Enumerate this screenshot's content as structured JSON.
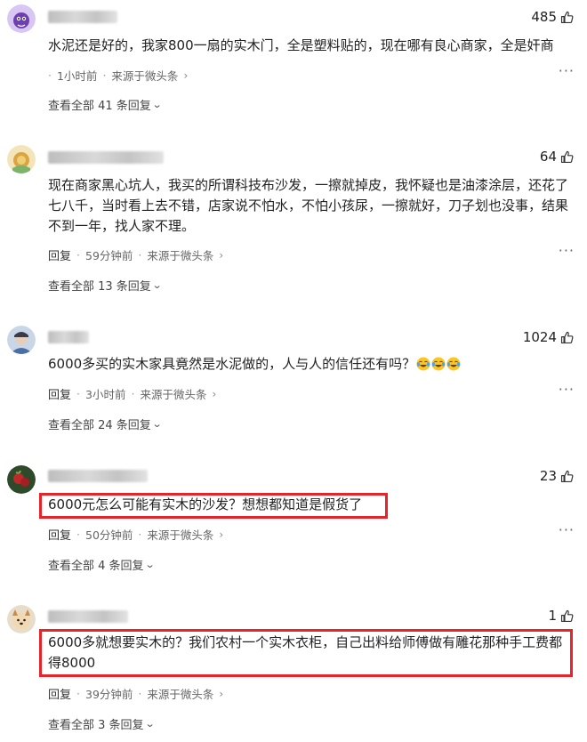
{
  "comments": [
    {
      "likes": "485",
      "text": "水泥还是好的，我家800一扇的实木门，全是塑料贴的，现在哪有良心商家，全是奸商",
      "time": "1小时前",
      "source": "来源于微头条",
      "has_reply_label": false,
      "view_all": "查看全部 41 条回复"
    },
    {
      "likes": "64",
      "text": "现在商家黑心坑人，我买的所谓科技布沙发，一擦就掉皮，我怀疑也是油漆涂层，还花了七八千，当时看上去不错，店家说不怕水，不怕小孩尿，一擦就好，刀子划也没事，结果不到一年，找人家不理。",
      "time": "59分钟前",
      "source": "来源于微头条",
      "has_reply_label": true,
      "view_all": "查看全部 13 条回复"
    },
    {
      "likes": "1024",
      "text": "6000多买的实木家具竟然是水泥做的，人与人的信任还有吗？",
      "emoji": [
        "crying-laughing",
        "crying-laughing",
        "crying-laughing"
      ],
      "time": "3小时前",
      "source": "来源于微头条",
      "has_reply_label": true,
      "view_all": "查看全部 24 条回复"
    },
    {
      "likes": "23",
      "text": "6000元怎么可能有实木的沙发？想想都知道是假货了",
      "time": "50分钟前",
      "source": "来源于微头条",
      "has_reply_label": true,
      "view_all": "查看全部 4 条回复",
      "highlighted": true
    },
    {
      "likes": "1",
      "text": "6000多就想要实木的？我们农村一个实木衣柜，自己出料给师傅做有雕花那种手工费都得8000",
      "time": "39分钟前",
      "source": "来源于微头条",
      "has_reply_label": true,
      "view_all": "查看全部 3 条回复",
      "highlighted": true
    }
  ],
  "labels": {
    "reply": "回复",
    "more": "···"
  },
  "colors": {
    "highlight": "#e8242b",
    "meta": "#666666",
    "text": "#222222"
  }
}
